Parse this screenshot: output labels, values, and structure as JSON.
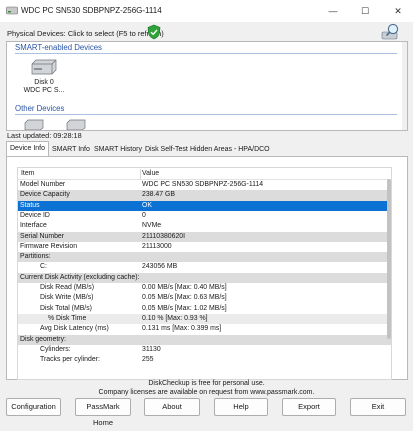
{
  "window": {
    "title": "WDC PC SN530 SDBPNPZ-256G-1114",
    "minimize_glyph": "—",
    "maximize_glyph": "☐",
    "close_glyph": "✕"
  },
  "header": {
    "physical_devices_label": "Physical Devices: Click to select (F5 to refresh)"
  },
  "devices": {
    "smart_group": "SMART-enabled Devices",
    "other_group": "Other Devices",
    "disk0_line1": "Disk 0",
    "disk0_line2": "WDC PC S..."
  },
  "last_updated": "Last updated: 09:28:18",
  "tabs": [
    {
      "label": "Device Info"
    },
    {
      "label": "SMART Info"
    },
    {
      "label": "SMART History"
    },
    {
      "label": "Disk Self-Test"
    },
    {
      "label": "Hidden Areas - HPA/DCO"
    }
  ],
  "table": {
    "col_item": "Item",
    "col_value": "Value",
    "rows": [
      {
        "k": "Model Number",
        "v": "WDC PC SN530 SDBPNPZ-256G-1114"
      },
      {
        "k": "Device Capacity",
        "v": "238.47 GB"
      },
      {
        "k": "Status",
        "v": "OK"
      },
      {
        "k": "Device ID",
        "v": "0"
      },
      {
        "k": "Interface",
        "v": "NVMe"
      },
      {
        "k": "Serial Number",
        "v": "21110380620I"
      },
      {
        "k": "Firmware Revision",
        "v": "21113000"
      },
      {
        "k": "Partitions:",
        "v": ""
      },
      {
        "k": "C:",
        "v": "243056 MB"
      },
      {
        "k": "Current Disk Activity (excluding cache):",
        "v": ""
      },
      {
        "k": "Disk Read (MB/s)",
        "v": "0.00 MB/s  [Max: 0.40 MB/s]"
      },
      {
        "k": "Disk Write (MB/s)",
        "v": "0.05 MB/s  [Max: 0.63 MB/s]"
      },
      {
        "k": "Disk Total (MB/s)",
        "v": "0.05 MB/s  [Max: 1.02 MB/s]"
      },
      {
        "k": "% Disk Time",
        "v": "0.10 %    [Max: 0.93 %]"
      },
      {
        "k": "Avg Disk Latency (ms)",
        "v": "0.131 ms  [Max: 0.399 ms]"
      },
      {
        "k": "Disk geometry:",
        "v": ""
      },
      {
        "k": "Cylinders:",
        "v": "31130"
      },
      {
        "k": "Tracks per cylinder:",
        "v": "255"
      }
    ]
  },
  "footer": {
    "line1": "DiskCheckup is free for personal use.",
    "line2": "Company licenses are available on request from www.passmark.com."
  },
  "buttons": {
    "configuration": "Configuration",
    "passmark_home": "PassMark Home",
    "about": "About",
    "help": "Help",
    "export": "Export",
    "exit": "Exit"
  }
}
